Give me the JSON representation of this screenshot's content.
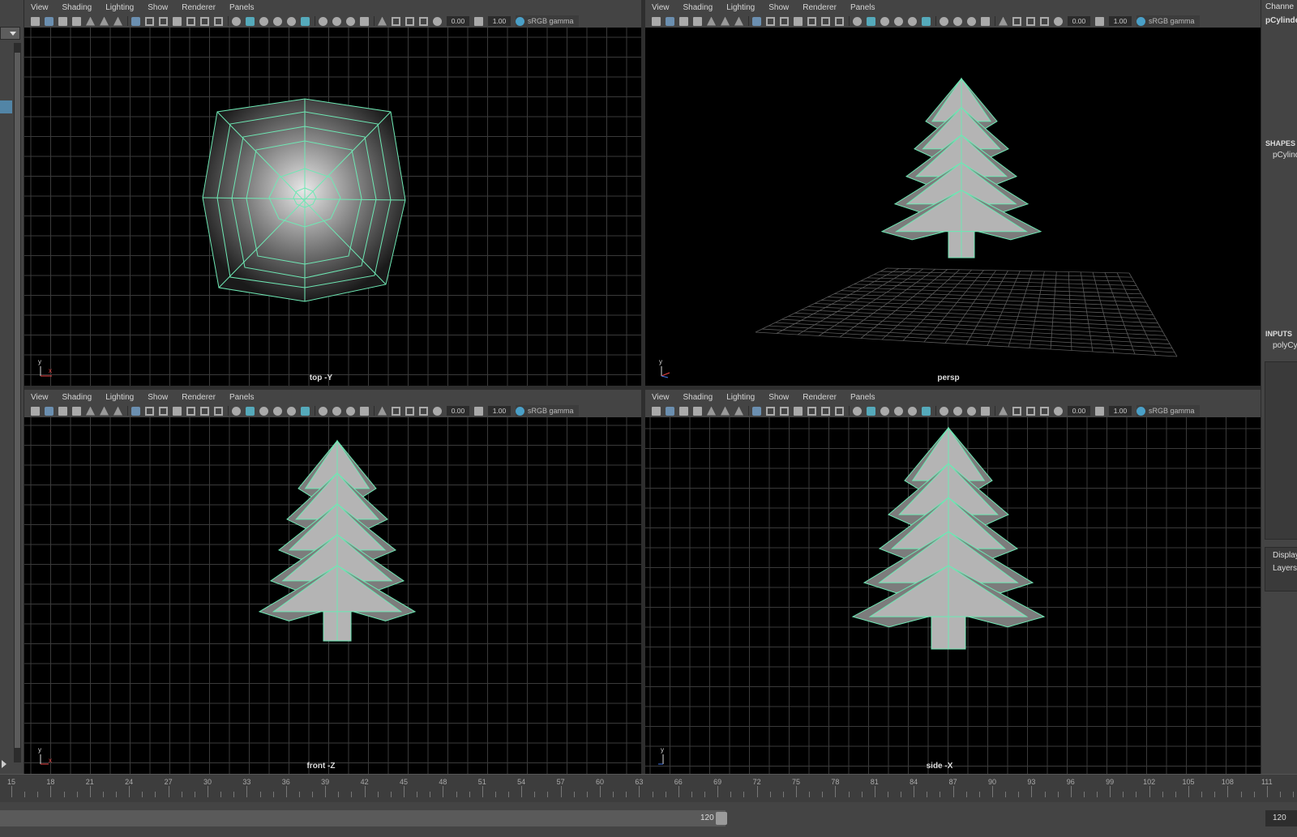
{
  "menu": [
    "View",
    "Shading",
    "Lighting",
    "Show",
    "Renderer",
    "Panels"
  ],
  "toolbar": {
    "field1": "0.00",
    "field2": "1.00",
    "color_space": "sRGB gamma"
  },
  "panels": [
    {
      "id": "top",
      "label": "top -Y"
    },
    {
      "id": "persp",
      "label": "persp"
    },
    {
      "id": "front",
      "label": "front -Z"
    },
    {
      "id": "side",
      "label": "side -X"
    }
  ],
  "channel_box": {
    "header": "Channe",
    "object": "pCylinde",
    "shapes_title": "SHAPES",
    "shape": "pCylind",
    "inputs_title": "INPUTS",
    "input": "polyCy",
    "display": "Display",
    "layers": "Layers"
  },
  "timeline": {
    "frames": [
      "15",
      "18",
      "21",
      "24",
      "27",
      "30",
      "33",
      "36",
      "39",
      "42",
      "45",
      "48",
      "51",
      "54",
      "57",
      "60",
      "63",
      "66",
      "69",
      "72",
      "75",
      "78",
      "81",
      "84",
      "87",
      "90",
      "93",
      "96",
      "99",
      "102",
      "105",
      "108",
      "111"
    ]
  },
  "range": {
    "end_frame": "120",
    "end_field": "120"
  },
  "colors": {
    "wire": "#6ee8b4",
    "grid": "#3a3a3a",
    "surface": "#b4b4b4",
    "surface_shadow": "#7c7c7c",
    "viewport_bg": "#000000"
  }
}
